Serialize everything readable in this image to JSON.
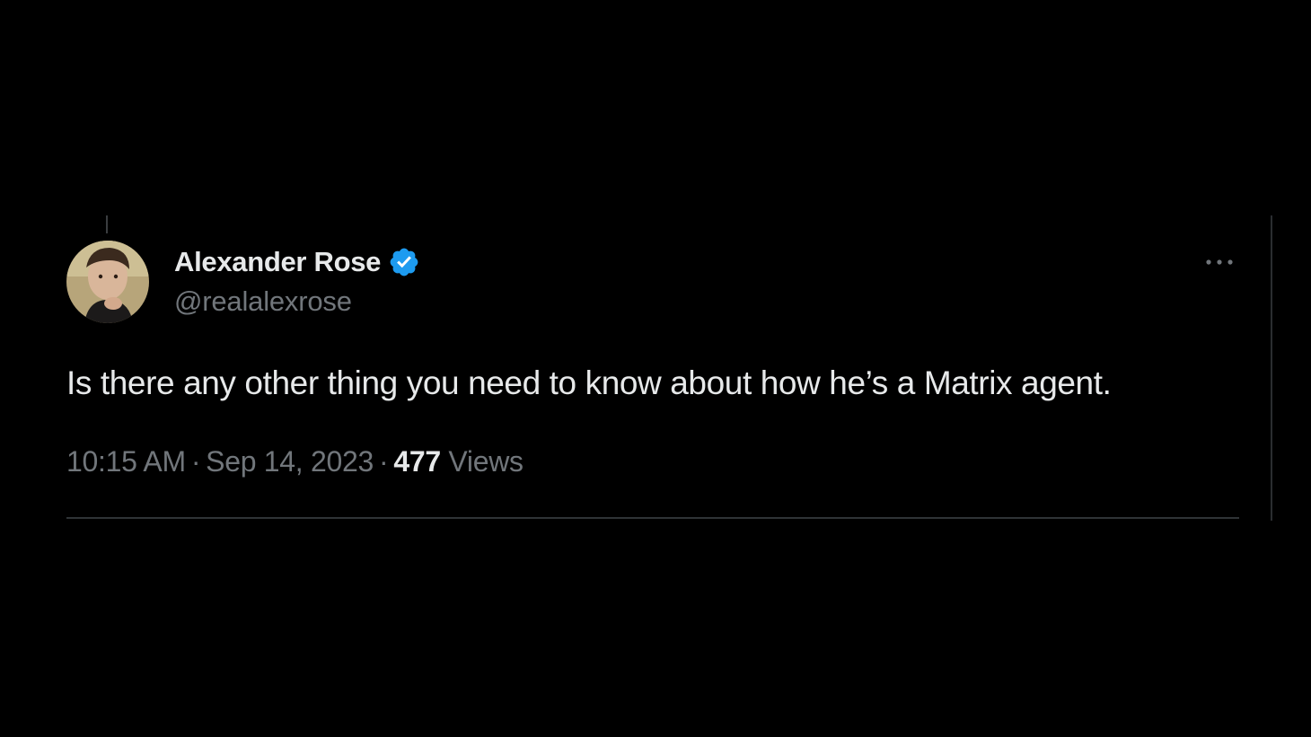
{
  "tweet": {
    "author": {
      "display_name": "Alexander Rose",
      "handle": "@realalexrose",
      "verified_icon": "verified-badge-icon",
      "avatar_icon": "avatar-photo"
    },
    "text": "Is there any other thing you need to know about how he’s a Matrix agent.",
    "meta": {
      "time": "10:15 AM",
      "separator": "·",
      "date": "Sep 14, 2023",
      "views_count": "477",
      "views_label": "Views"
    },
    "more_icon": "more-options-icon"
  },
  "colors": {
    "background": "#000000",
    "primary_text": "#e7e9ea",
    "secondary_text": "#71767b",
    "verified_blue": "#1d9bf0",
    "divider": "#2f3336"
  }
}
